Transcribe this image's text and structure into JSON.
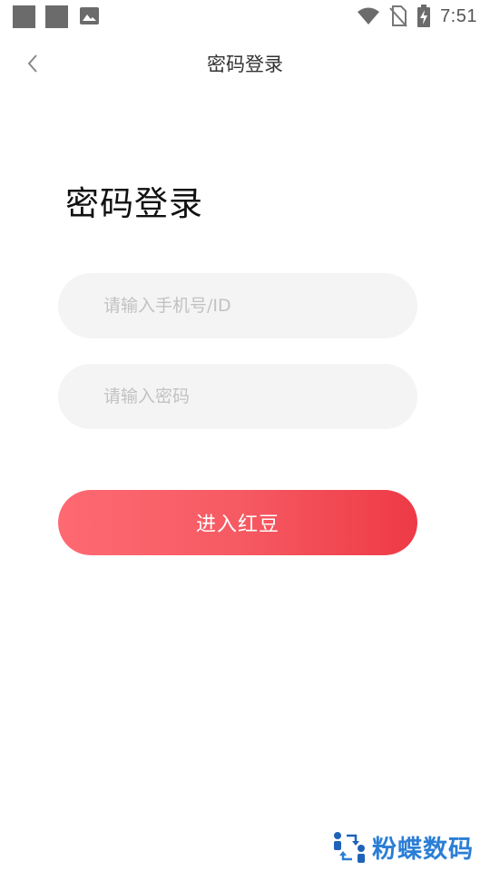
{
  "status_bar": {
    "time": "7:51",
    "icons": [
      "notification-square-icon",
      "notification-square-icon",
      "image-icon",
      "wifi-icon",
      "no-sim-icon",
      "battery-charging-icon"
    ]
  },
  "nav": {
    "back_icon": "chevron-left-icon",
    "title": "密码登录"
  },
  "main": {
    "heading": "密码登录",
    "phone_placeholder": "请输入手机号/ID",
    "phone_value": "",
    "password_placeholder": "请输入密码",
    "password_value": "",
    "submit_label": "进入红豆"
  },
  "watermark": {
    "text": "粉蝶数码"
  },
  "colors": {
    "button_gradient_start": "#fe6a72",
    "button_gradient_end": "#ee3a46",
    "input_background": "#f4f4f4",
    "placeholder": "#c2c2c2",
    "watermark": "#2a7ed6"
  }
}
